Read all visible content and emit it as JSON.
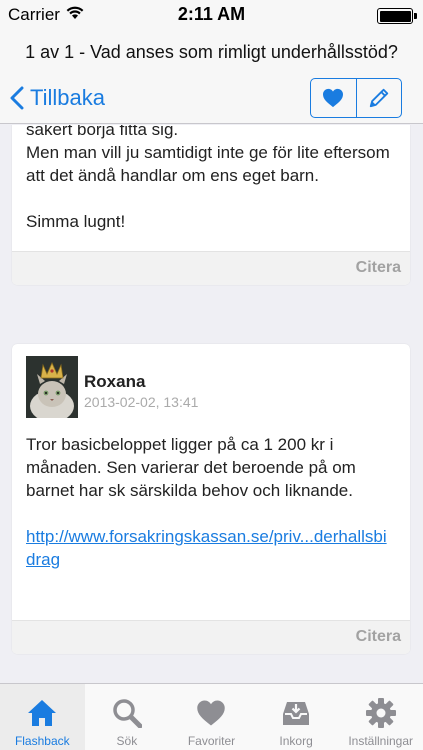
{
  "status_bar": {
    "carrier": "Carrier",
    "time": "2:11 AM",
    "battery_level": 1.0
  },
  "thread": {
    "title": "1 av 1 - Vad anses som rimligt underhållsstöd?"
  },
  "nav": {
    "back_label": "Tillbaka",
    "favorite_icon": "heart-icon",
    "compose_icon": "pencil-icon"
  },
  "posts": [
    {
      "body": [
        "sakert borja fitta sig.\nMen man vill ju samtidigt inte ge för lite eftersom att det ändå handlar om ens eget barn.",
        "Simma lugnt!"
      ],
      "cite_label": "Citera"
    },
    {
      "author": "Roxana",
      "timestamp": "2013-02-02, 13:41",
      "body": [
        "Tror basicbeloppet ligger på ca 1 200 kr i månaden. Sen varierar det beroende på om barnet har sk särskilda behov och liknande."
      ],
      "link": "http://www.forsakringskassan.se/priv...derhallsbidrag",
      "cite_label": "Citera"
    }
  ],
  "tabs": [
    {
      "label": "Flashback",
      "icon": "home-icon",
      "active": true
    },
    {
      "label": "Sök",
      "icon": "search-icon",
      "active": false
    },
    {
      "label": "Favoriter",
      "icon": "heart-icon",
      "active": false
    },
    {
      "label": "Inkorg",
      "icon": "inbox-icon",
      "active": false
    },
    {
      "label": "Inställningar",
      "icon": "gear-icon",
      "active": false
    }
  ],
  "colors": {
    "accent": "#1a7ce0",
    "inactive": "#8e8e93",
    "cite": "#a2a2a2"
  }
}
